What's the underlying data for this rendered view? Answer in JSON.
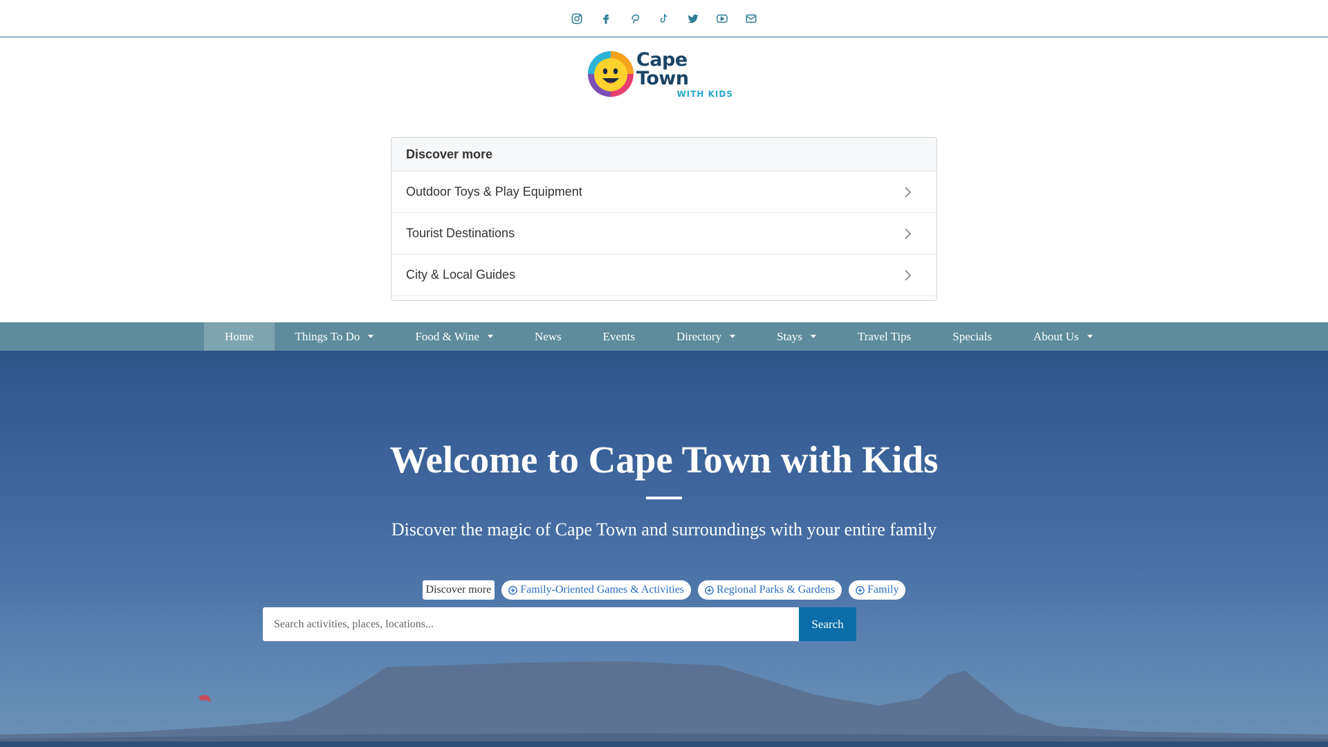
{
  "social": {
    "icons": [
      "instagram-icon",
      "facebook-icon",
      "pinterest-icon",
      "tiktok-icon",
      "twitter-icon",
      "youtube-icon",
      "email-icon"
    ]
  },
  "logo": {
    "main": "Cape Town",
    "sub": "WITH KIDS"
  },
  "discover_panel": {
    "header": "Discover more",
    "items": [
      {
        "label": "Outdoor Toys & Play Equipment"
      },
      {
        "label": "Tourist Destinations"
      },
      {
        "label": "City & Local Guides"
      }
    ]
  },
  "nav": {
    "items": [
      {
        "label": "Home",
        "active": true,
        "dropdown": false
      },
      {
        "label": "Things To Do",
        "dropdown": true
      },
      {
        "label": "Food & Wine",
        "dropdown": true
      },
      {
        "label": "News",
        "dropdown": false
      },
      {
        "label": "Events",
        "dropdown": false
      },
      {
        "label": "Directory",
        "dropdown": true
      },
      {
        "label": "Stays",
        "dropdown": true
      },
      {
        "label": "Travel Tips",
        "dropdown": false
      },
      {
        "label": "Specials",
        "dropdown": false
      },
      {
        "label": "About Us",
        "dropdown": true
      }
    ]
  },
  "hero": {
    "title": "Welcome to Cape Town with Kids",
    "subtitle": "Discover the magic of Cape Town and surroundings with your entire family",
    "tags_label": "Discover more",
    "tags": [
      {
        "label": "Family-Oriented Games & Activities"
      },
      {
        "label": "Regional Parks & Gardens"
      },
      {
        "label": "Family"
      }
    ],
    "search": {
      "placeholder": "Search activities, places, locations...",
      "value": "",
      "button": "Search"
    }
  },
  "colors": {
    "nav_bg": "#5e8c9c",
    "nav_active": "#7fa4b1",
    "social_icon": "#2f7d95",
    "search_button": "#0b6ea8",
    "tag_text": "#2a6fc0"
  }
}
